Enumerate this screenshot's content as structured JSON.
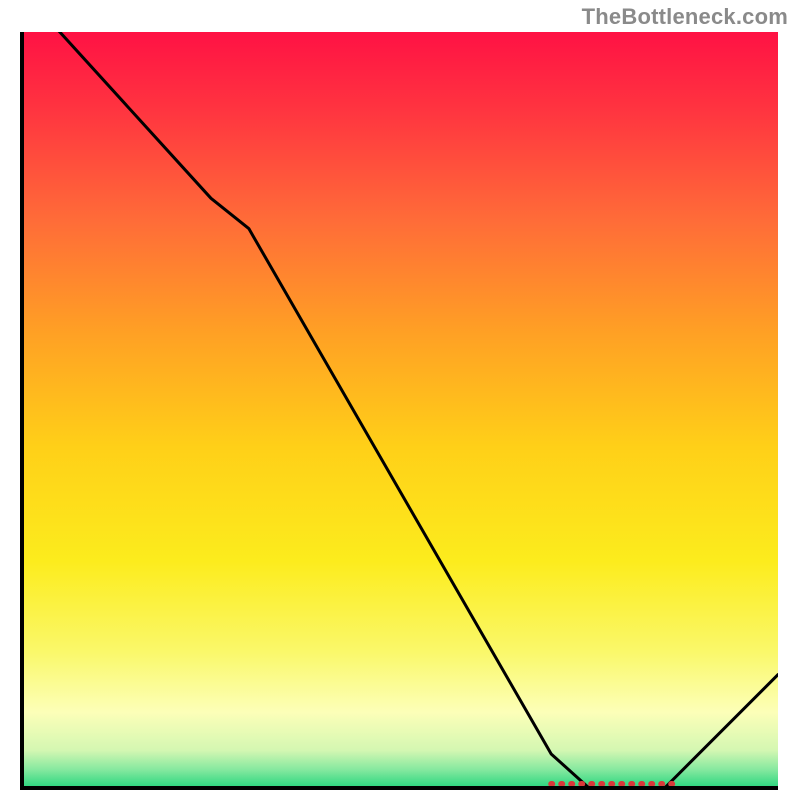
{
  "watermark": "TheBottleneck.com",
  "chart_data": {
    "type": "line",
    "title": "",
    "xlabel": "",
    "ylabel": "",
    "xlim": [
      0,
      100
    ],
    "ylim": [
      0,
      100
    ],
    "x": [
      0,
      5,
      25,
      30,
      70,
      75,
      85,
      100
    ],
    "values": [
      105,
      100,
      78,
      74,
      4.5,
      0,
      0,
      15
    ],
    "marker_region": {
      "start": 70,
      "end": 86,
      "y": 0
    },
    "background": {
      "type": "vertical-gradient",
      "stops": [
        {
          "offset": 0.0,
          "color": "#ff1244"
        },
        {
          "offset": 0.1,
          "color": "#ff3340"
        },
        {
          "offset": 0.25,
          "color": "#ff6c38"
        },
        {
          "offset": 0.4,
          "color": "#ffa124"
        },
        {
          "offset": 0.55,
          "color": "#ffd018"
        },
        {
          "offset": 0.7,
          "color": "#fcec1d"
        },
        {
          "offset": 0.82,
          "color": "#faf86a"
        },
        {
          "offset": 0.9,
          "color": "#fcffb8"
        },
        {
          "offset": 0.95,
          "color": "#d4f7b2"
        },
        {
          "offset": 0.975,
          "color": "#88e9a0"
        },
        {
          "offset": 1.0,
          "color": "#28d67e"
        }
      ]
    },
    "line_color": "#000000",
    "frame_color": "#000000"
  }
}
